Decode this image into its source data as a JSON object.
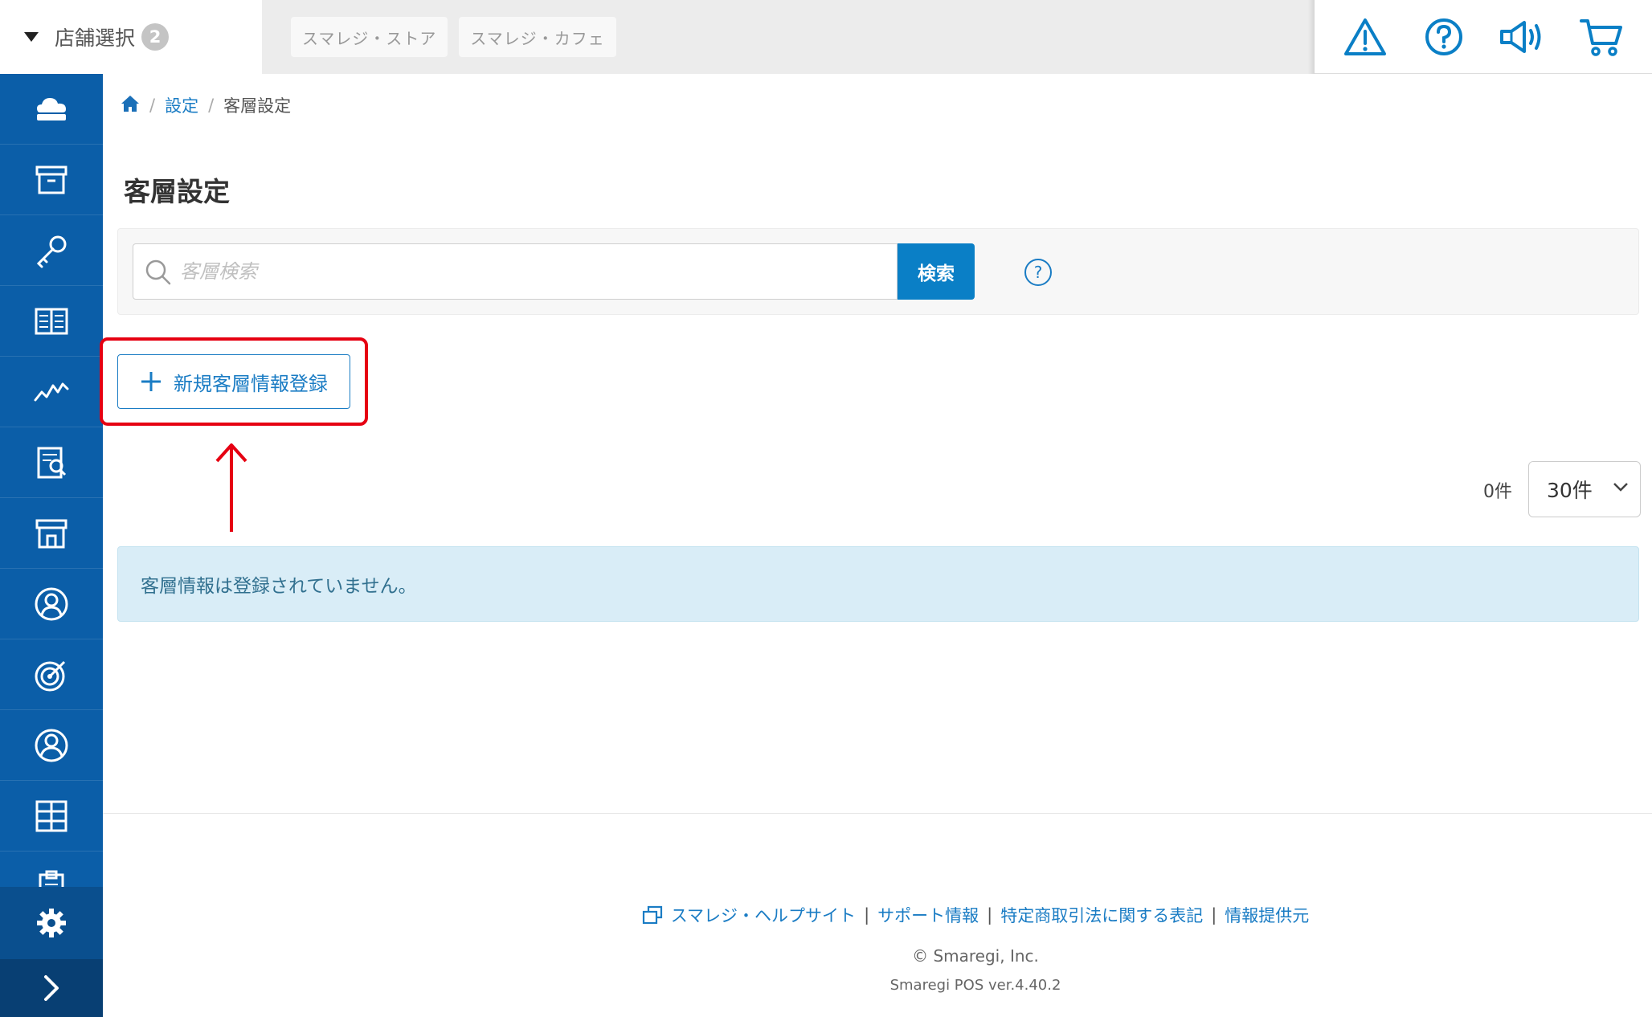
{
  "store_select": {
    "label": "店舗選択",
    "count": "2"
  },
  "store_tabs": [
    "スマレジ・ストア",
    "スマレジ・カフェ"
  ],
  "top_icons": [
    "warning-icon",
    "help-icon",
    "megaphone-icon",
    "cart-icon"
  ],
  "sidebar": {
    "items": [
      "cloud-register-icon",
      "archive-box-icon",
      "key-icon",
      "book-icon",
      "chart-line-icon",
      "report-icon",
      "store-icon",
      "person-icon",
      "target-icon",
      "user-icon",
      "grid-icon",
      "clipboard-icon"
    ],
    "settings_icon": "gear-icon",
    "expand_icon": "chevron-right-icon"
  },
  "breadcrumb": {
    "home_icon": "home-icon",
    "settings": "設定",
    "current": "客層設定"
  },
  "page": {
    "title": "客層設定"
  },
  "search": {
    "placeholder": "客層検索",
    "value": "",
    "button": "検索",
    "help": "?"
  },
  "actions": {
    "add_label": "新規客層情報登録"
  },
  "list": {
    "count": "0件",
    "per_page": "30件",
    "empty_message": "客層情報は登録されていません。"
  },
  "footer": {
    "help_site": "スマレジ・ヘルプサイト",
    "support": "サポート情報",
    "law": "特定商取引法に関する表記",
    "info_provider": "情報提供元",
    "separator": "|",
    "copyright": "© Smaregi, Inc.",
    "version": "Smaregi POS ver.4.40.2"
  },
  "colors": {
    "sidebar": "#0b5ea8",
    "accent": "#0a7fc6",
    "highlight": "#e60012",
    "alert_bg": "#d9edf7"
  }
}
